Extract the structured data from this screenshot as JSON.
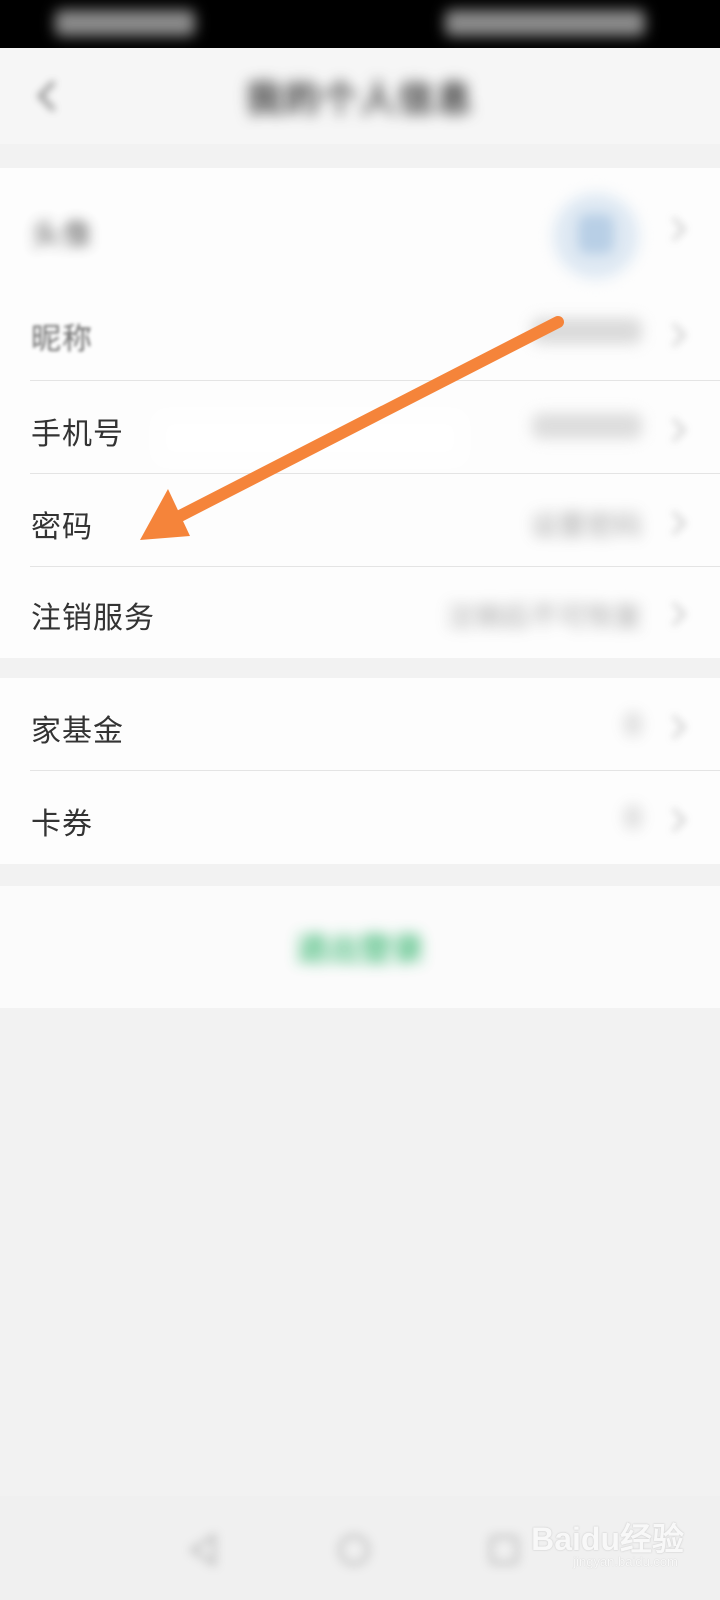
{
  "nav": {
    "title": "我的个人信息",
    "back_icon": "back-chevron-icon"
  },
  "profile": {
    "rows": [
      {
        "label": "头像",
        "value": ""
      },
      {
        "label": "昵称",
        "value": ""
      },
      {
        "label": "手机号",
        "value": ""
      },
      {
        "label": "密码",
        "value": "设置密码"
      },
      {
        "label": "注销服务",
        "value": "注销后不可恢复"
      }
    ]
  },
  "assets": {
    "rows": [
      {
        "label": "家基金",
        "value": "0"
      },
      {
        "label": "卡券",
        "value": "0"
      }
    ]
  },
  "logout": {
    "label": "退出登录"
  },
  "annotation": {
    "arrow_color": "#f5843a"
  },
  "watermark": {
    "logo": "Baidu经验",
    "url": "jingyan.baidu.com"
  },
  "colors": {
    "accent_green": "#2fb36a",
    "background": "#f2f2f2",
    "card": "#fdfdfd",
    "arrow": "#f5843a"
  }
}
